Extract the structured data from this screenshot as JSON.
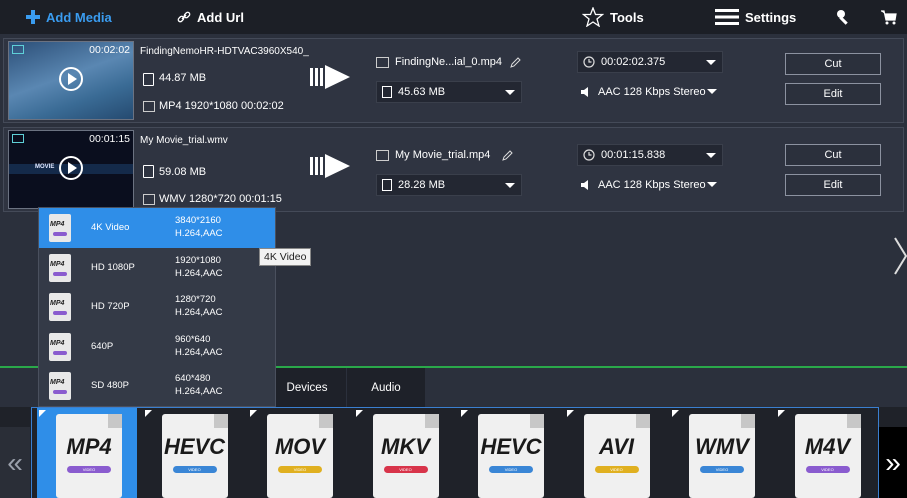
{
  "toolbar": {
    "add_media": "Add Media",
    "add_url": "Add Url",
    "tools": "Tools",
    "settings": "Settings"
  },
  "tasks": [
    {
      "duration": "00:02:02",
      "filename": "FindingNemoHR-HDTVAC3960X540_",
      "size": "44.87 MB",
      "info": "MP4 1920*1080 00:02:02",
      "output_name": "FindingNe...ial_0.mp4",
      "output_size": "45.63 MB",
      "output_time": "00:02:02.375",
      "audio": "AAC 128 Kbps Stereo",
      "cut_label": "Cut",
      "edit_label": "Edit"
    },
    {
      "duration": "00:01:15",
      "filename": "My Movie_trial.wmv",
      "size": "59.08 MB",
      "info": "WMV 1280*720 00:01:15",
      "output_name": "My Movie_trial.mp4",
      "output_size": "28.28 MB",
      "output_time": "00:01:15.838",
      "audio": "AAC 128 Kbps Stereo",
      "cut_label": "Cut",
      "edit_label": "Edit",
      "thumb_text": "MOVIE"
    }
  ],
  "dropdown": {
    "icon_label": "MP4",
    "items": [
      {
        "label": "4K Video",
        "res": "3840*2160",
        "codec": "H.264,AAC",
        "selected": true
      },
      {
        "label": "HD 1080P",
        "res": "1920*1080",
        "codec": "H.264,AAC"
      },
      {
        "label": "HD 720P",
        "res": "1280*720",
        "codec": "H.264,AAC"
      },
      {
        "label": "640P",
        "res": "960*640",
        "codec": "H.264,AAC"
      },
      {
        "label": "SD 480P",
        "res": "640*480",
        "codec": "H.264,AAC"
      }
    ],
    "tooltip": "4K Video"
  },
  "tabs": {
    "devices": "Devices",
    "audio": "Audio"
  },
  "formats": [
    {
      "name": "MP4",
      "color": "#8a5ccf",
      "selected": true
    },
    {
      "name": "HEVC",
      "color": "#3a86d6"
    },
    {
      "name": "MOV",
      "color": "#e0b020"
    },
    {
      "name": "MKV",
      "color": "#d8344a"
    },
    {
      "name": "HEVC",
      "color": "#3a86d6"
    },
    {
      "name": "AVI",
      "color": "#e0b020"
    },
    {
      "name": "WMV",
      "color": "#3a86d6"
    },
    {
      "name": "M4V",
      "color": "#8a5ccf"
    }
  ],
  "format_bar_text": "VIDEO",
  "nav": {
    "prev": "«",
    "next": "»"
  }
}
